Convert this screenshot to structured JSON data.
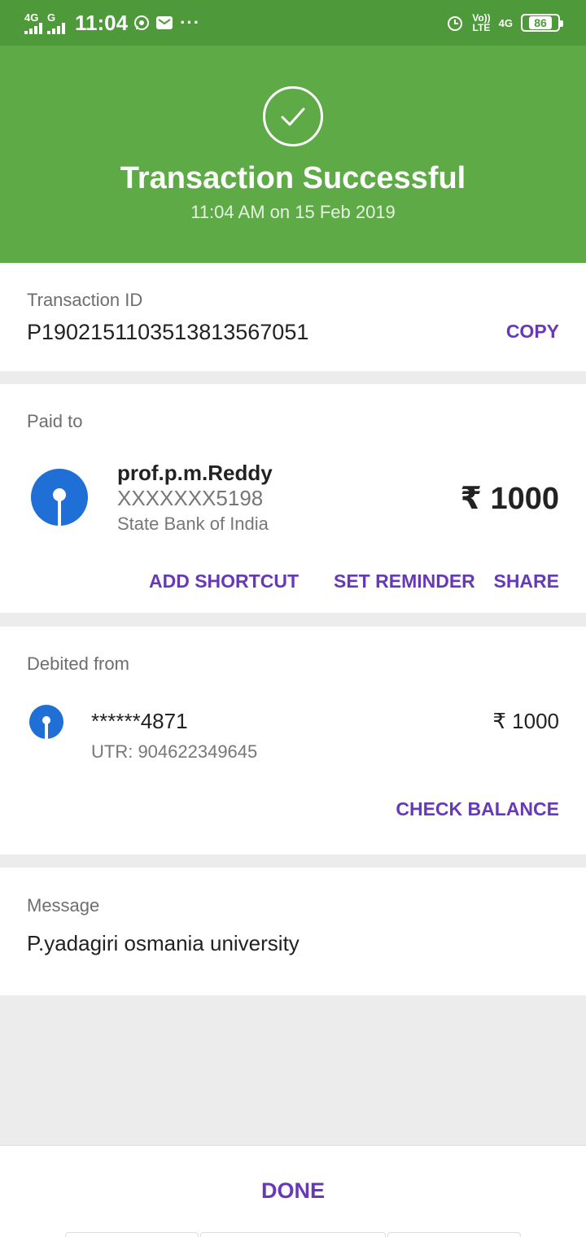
{
  "status_bar": {
    "sim1_network": "4G",
    "sim2_network": "G",
    "time": "11:04",
    "volte_line1": "Vo))",
    "volte_line2": "LTE",
    "network_right": "4G",
    "battery": "86",
    "overflow": "···"
  },
  "header": {
    "title": "Transaction Successful",
    "datetime": "11:04 AM on 15 Feb 2019"
  },
  "transaction": {
    "label": "Transaction ID",
    "id": "P1902151103513813567051",
    "copy_label": "COPY"
  },
  "paid_to": {
    "label": "Paid to",
    "name": "prof.p.m.Reddy",
    "account": "XXXXXXX5198",
    "bank": "State Bank of India",
    "amount": "₹ 1000",
    "actions": {
      "add_shortcut": "ADD SHORTCUT",
      "set_reminder": "SET REMINDER",
      "share": "SHARE"
    }
  },
  "debited_from": {
    "label": "Debited from",
    "account": "******4871",
    "utr": "UTR: 904622349645",
    "amount": "₹ 1000",
    "check_balance": "CHECK BALANCE"
  },
  "message": {
    "label": "Message",
    "text": "P.yadagiri osmania university"
  },
  "footer": {
    "done_label": "DONE"
  },
  "colors": {
    "status_bar": "#4e9a3a",
    "header": "#5daa46",
    "accent": "#6739b7",
    "bank_logo": "#1f6fd6"
  }
}
